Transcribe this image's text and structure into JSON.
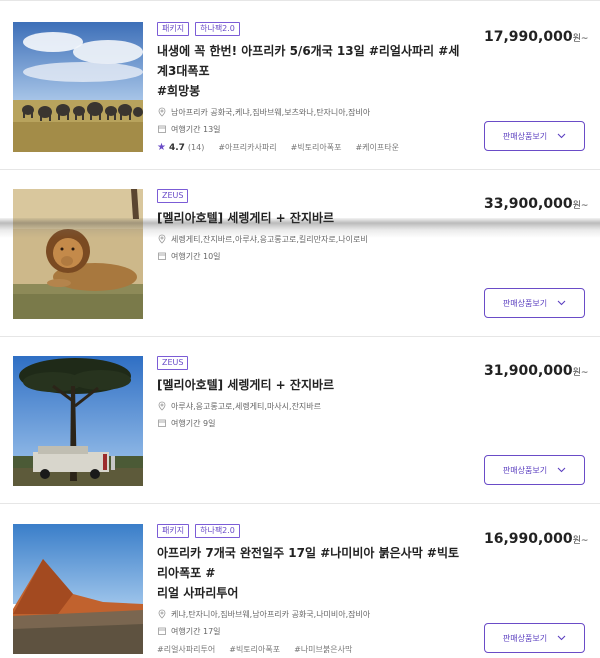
{
  "products": [
    {
      "badges": [
        "패키지",
        "하나팩2.0"
      ],
      "title_line1": "내생에 꼭 한번! 아프리카 5/6개국 13일 #리얼사파리 #세계3대폭포",
      "title_line2": "#희망봉",
      "cities": "남아프리카 공화국,케냐,짐바브웨,보츠와나,탄자니아,잠비아",
      "duration": "여행기간 13일",
      "rating": "4.7",
      "review_count": "(14)",
      "tags": [
        "#아프리카사파리",
        "#빅토리아폭포",
        "#케이프타운"
      ],
      "price": "17,990,000",
      "price_unit": "원~",
      "button_label": "판매상품보기",
      "image": "elephants-savanna"
    },
    {
      "badges": [
        "ZEUS"
      ],
      "title_line1": "[멜리아호텔] 세렝게티 + 잔지바르",
      "cities": "세렝게티,잔지바르,아루샤,응고롱고로,킬리만자로,나이로비",
      "duration": "여행기간 10일",
      "price": "33,900,000",
      "price_unit": "원~",
      "button_label": "판매상품보기",
      "image": "lion"
    },
    {
      "badges": [
        "ZEUS"
      ],
      "title_line1": "[멜리아호텔] 세렝게티 + 잔지바르",
      "cities": "아루샤,응고롱고로,세렝게티,마사시,잔지바르",
      "duration": "여행기간 9일",
      "price": "31,900,000",
      "price_unit": "원~",
      "button_label": "판매상품보기",
      "image": "acacia-safari-jeep"
    },
    {
      "badges": [
        "패키지",
        "하나팩2.0"
      ],
      "title_line1": "아프리카 7개국 완전일주 17일 #나미비아 붉은사막 #빅토리아폭포 #",
      "title_line2": "리얼 사파리투어",
      "cities": "케냐,탄자니아,짐바브웨,남아프리카 공화국,나미비아,잠비아",
      "duration": "여행기간 17일",
      "tags": [
        "#리얼사파리투어",
        "#빅토리아폭포",
        "#나미브붉은사막"
      ],
      "price": "16,990,000",
      "price_unit": "원~",
      "button_label": "판매상품보기",
      "image": "red-dunes"
    }
  ],
  "colors": {
    "accent": "#6a4cc7",
    "divider": "#e6e6e6"
  },
  "icons": {
    "location": "map-pin-icon",
    "calendar": "calendar-icon",
    "star": "star-icon",
    "chevron": "chevron-down-icon"
  }
}
